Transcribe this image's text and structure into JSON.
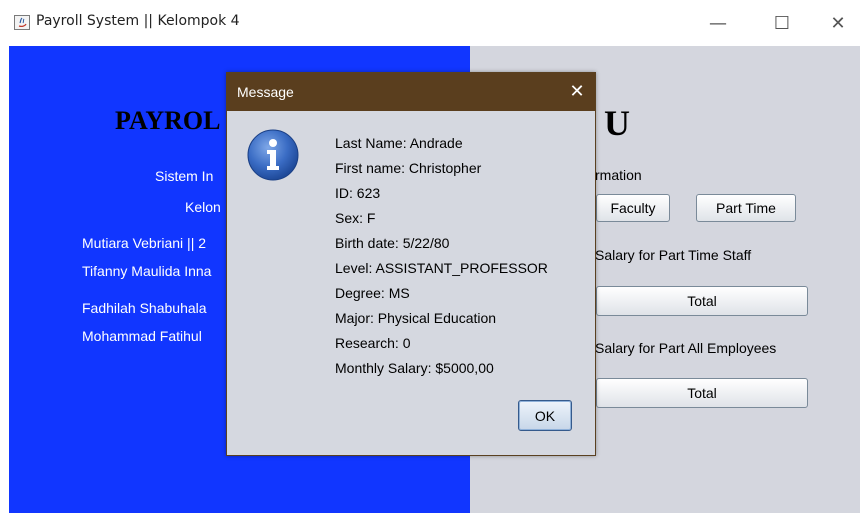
{
  "window": {
    "title": "Payroll System || Kelompok 4",
    "minimize": "—",
    "maximize": "☐",
    "close": "✕"
  },
  "left_panel": {
    "title_visible": "PAYROL",
    "line1_visible": "Sistem In",
    "line2_visible": "Kelon",
    "members_visible": [
      "Mutiara Vebriani || 2",
      "Tifanny Maulida Inna",
      "Fadhilah Shabuhala",
      "Mohammad Fatihul"
    ]
  },
  "right_panel": {
    "title_visible": "U",
    "info_label_visible": "rmation",
    "faculty_button": "Faculty",
    "parttime_button": "Part Time",
    "salary_parttime_label": "Salary for Part Time Staff",
    "total_button_1": "Total",
    "salary_all_label": "Salary for Part All Employees",
    "total_button_2": "Total"
  },
  "dialog": {
    "title": "Message",
    "close": "✕",
    "icon": "info-icon",
    "lines": [
      "Last Name: Andrade",
      "First name: Christopher",
      "ID: 623",
      "Sex: F",
      "Birth date: 5/22/80",
      "Level: ASSISTANT_PROFESSOR",
      "Degree: MS",
      "Major: Physical Education",
      "Research: 0",
      "Monthly Salary: $5000,00"
    ],
    "ok_label": "OK"
  },
  "colors": {
    "left_panel_bg": "#1136ff",
    "right_panel_bg": "#d4d6de",
    "dialog_titlebar": "#5a3e1e",
    "dialog_bg": "#d5d8e0"
  }
}
